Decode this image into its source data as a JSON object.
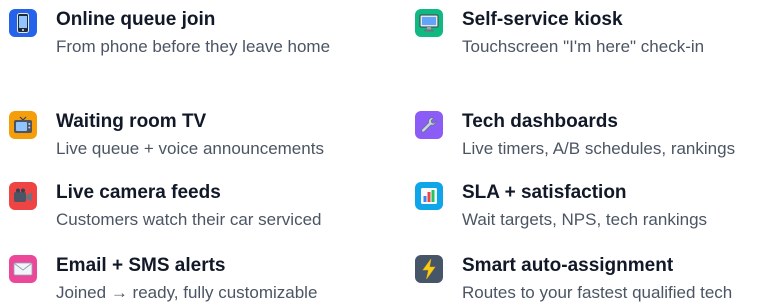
{
  "features": [
    {
      "icon": "phone-icon",
      "color": "#2563eb",
      "title": "Online queue join",
      "description": "From phone before they leave home"
    },
    {
      "icon": "monitor-icon",
      "color": "#10b981",
      "title": "Self-service kiosk",
      "description": "Touchscreen \"I'm here\" check-in"
    },
    {
      "icon": "tv-icon",
      "color": "#f59e0b",
      "title": "Waiting room TV",
      "description": "Live queue + voice announcements"
    },
    {
      "icon": "wrench-icon",
      "color": "#8b5cf6",
      "title": "Tech dashboards",
      "description": "Live timers, A/B schedules, rankings"
    },
    {
      "icon": "video-camera-icon",
      "color": "#ef4444",
      "title": "Live camera feeds",
      "description": "Customers watch their car serviced"
    },
    {
      "icon": "bar-chart-icon",
      "color": "#0ea5e9",
      "title": "SLA + satisfaction",
      "description": "Wait targets, NPS, tech rankings"
    },
    {
      "icon": "envelope-icon",
      "color": "#ec4899",
      "title": "Email + SMS alerts",
      "description": "Joined → ready, fully customizable"
    },
    {
      "icon": "lightning-icon",
      "color": "#475569",
      "title": "Smart auto-assignment",
      "description": "Routes to your fastest qualified tech"
    }
  ]
}
